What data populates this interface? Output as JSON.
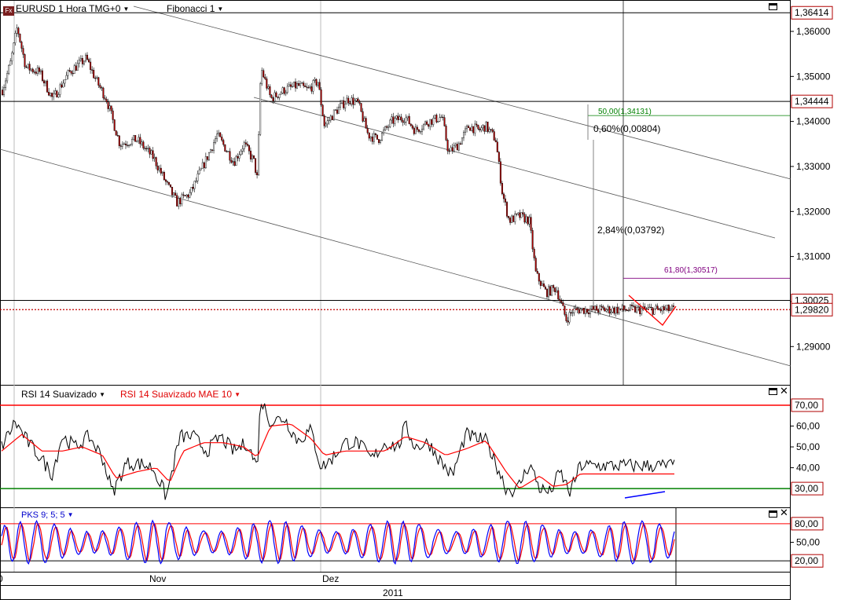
{
  "header": {
    "symbol_icon": "fx-icon",
    "symbol_label": "EURUSD 1 Hora TMG+0",
    "study_label": "Fibonacci 1"
  },
  "rsi_panel": {
    "title": "RSI 14 Suavizado",
    "ma_title": "RSI 14 Suavizado MAE 10"
  },
  "pks_panel": {
    "title": "PKS 9; 5; 5"
  },
  "x_axis": {
    "labels": [
      "Nov",
      "Dez"
    ],
    "year": "2011",
    "edge_label": "0"
  },
  "colors": {
    "price_up": "#000000",
    "price_down": "#b00000",
    "rsi_line": "#000000",
    "rsi_ma": "#ff0000",
    "pks_fast": "#0000ff",
    "pks_slow": "#ff0000",
    "upper_band": "#ff0000",
    "lower_band": "#008000",
    "fib_50": "#008000",
    "fib_618": "#800080",
    "axis_box_border": "#b00000"
  },
  "chart_data": [
    {
      "type": "candlestick",
      "title": "EURUSD 1 Hora TMG+0",
      "ylim": [
        1.2815,
        1.3668
      ],
      "yticks": [
        "1,36000",
        "1,35000",
        "1,34000",
        "1,33000",
        "1,32000",
        "1,31000",
        "1,30000",
        "1,29000"
      ],
      "tick_values": [
        1.36,
        1.35,
        1.34,
        1.33,
        1.32,
        1.31,
        1.3,
        1.29
      ],
      "value_boxes": [
        {
          "label": "1,36414",
          "value": 1.36414
        },
        {
          "label": "1,34444",
          "value": 1.34444
        },
        {
          "label": "1,30025",
          "value": 1.30025
        },
        {
          "label": "1,29820",
          "value": 1.2982
        }
      ],
      "horizontal_lines": [
        1.36414,
        1.34444,
        1.30025
      ],
      "current_price": 1.2982,
      "annotations": [
        {
          "text": "50,00(1,34131)",
          "value": 1.34131,
          "color": "#008000"
        },
        {
          "text": "0,60%(0,00804)"
        },
        {
          "text": "2,84%(0,03792)"
        },
        {
          "text": "61,80(1,30517)",
          "value": 1.30517,
          "color": "#800080"
        }
      ],
      "series": [
        {
          "name": "EURUSD",
          "path": [
            [
              0,
              1.347
            ],
            [
              0.012,
              1.353
            ],
            [
              0.022,
              1.361
            ],
            [
              0.035,
              1.352
            ],
            [
              0.055,
              1.351
            ],
            [
              0.075,
              1.345
            ],
            [
              0.1,
              1.351
            ],
            [
              0.125,
              1.354
            ],
            [
              0.14,
              1.349
            ],
            [
              0.155,
              1.345
            ],
            [
              0.175,
              1.335
            ],
            [
              0.2,
              1.336
            ],
            [
              0.225,
              1.332
            ],
            [
              0.245,
              1.326
            ],
            [
              0.26,
              1.322
            ],
            [
              0.28,
              1.324
            ],
            [
              0.305,
              1.332
            ],
            [
              0.32,
              1.337
            ],
            [
              0.345,
              1.331
            ],
            [
              0.36,
              1.335
            ],
            [
              0.375,
              1.331
            ],
            [
              0.38,
              1.327
            ],
            [
              0.385,
              1.352
            ],
            [
              0.4,
              1.345
            ],
            [
              0.42,
              1.347
            ],
            [
              0.44,
              1.348
            ],
            [
              0.455,
              1.347
            ],
            [
              0.47,
              1.349
            ],
            [
              0.48,
              1.339
            ],
            [
              0.495,
              1.342
            ],
            [
              0.515,
              1.345
            ],
            [
              0.53,
              1.344
            ],
            [
              0.545,
              1.337
            ],
            [
              0.56,
              1.336
            ],
            [
              0.58,
              1.34
            ],
            [
              0.6,
              1.341
            ],
            [
              0.615,
              1.338
            ],
            [
              0.635,
              1.34
            ],
            [
              0.655,
              1.341
            ],
            [
              0.665,
              1.333
            ],
            [
              0.68,
              1.335
            ],
            [
              0.695,
              1.339
            ],
            [
              0.71,
              1.338
            ],
            [
              0.72,
              1.339
            ],
            [
              0.735,
              1.336
            ],
            [
              0.745,
              1.324
            ],
            [
              0.755,
              1.318
            ],
            [
              0.77,
              1.319
            ],
            [
              0.785,
              1.318
            ],
            [
              0.795,
              1.306
            ],
            [
              0.81,
              1.302
            ],
            [
              0.825,
              1.303
            ],
            [
              0.84,
              1.296
            ],
            [
              0.85,
              1.298
            ],
            [
              0.86,
              1.2982
            ]
          ]
        }
      ]
    },
    {
      "type": "line",
      "title": "RSI 14 Suavizado",
      "ylim": [
        21,
        73
      ],
      "yticks": [
        "60,00",
        "50,00",
        "40,00"
      ],
      "tick_values": [
        60,
        50,
        40
      ],
      "bands": [
        {
          "label": "70,00",
          "value": 70,
          "color": "#ff0000"
        },
        {
          "label": "30,00",
          "value": 30,
          "color": "#008000"
        }
      ],
      "series": [
        {
          "name": "RSI 14 Suavizado",
          "path": [
            [
              0,
              50
            ],
            [
              0.02,
              62
            ],
            [
              0.04,
              52
            ],
            [
              0.06,
              44
            ],
            [
              0.075,
              37
            ],
            [
              0.09,
              55
            ],
            [
              0.11,
              50
            ],
            [
              0.13,
              55
            ],
            [
              0.15,
              45
            ],
            [
              0.165,
              28
            ],
            [
              0.185,
              42
            ],
            [
              0.205,
              42
            ],
            [
              0.225,
              40
            ],
            [
              0.245,
              26
            ],
            [
              0.265,
              55
            ],
            [
              0.285,
              55
            ],
            [
              0.305,
              48
            ],
            [
              0.325,
              55
            ],
            [
              0.345,
              48
            ],
            [
              0.365,
              52
            ],
            [
              0.38,
              40
            ],
            [
              0.385,
              73
            ],
            [
              0.4,
              62
            ],
            [
              0.42,
              64
            ],
            [
              0.44,
              53
            ],
            [
              0.46,
              58
            ],
            [
              0.475,
              40
            ],
            [
              0.49,
              44
            ],
            [
              0.51,
              52
            ],
            [
              0.53,
              52
            ],
            [
              0.55,
              44
            ],
            [
              0.57,
              52
            ],
            [
              0.59,
              50
            ],
            [
              0.6,
              60
            ],
            [
              0.615,
              50
            ],
            [
              0.635,
              52
            ],
            [
              0.655,
              42
            ],
            [
              0.67,
              36
            ],
            [
              0.69,
              56
            ],
            [
              0.705,
              54
            ],
            [
              0.72,
              53
            ],
            [
              0.735,
              42
            ],
            [
              0.75,
              30
            ],
            [
              0.765,
              29
            ],
            [
              0.785,
              42
            ],
            [
              0.8,
              30
            ],
            [
              0.815,
              28
            ],
            [
              0.83,
              38
            ],
            [
              0.845,
              28
            ],
            [
              0.86,
              41
            ]
          ]
        },
        {
          "name": "RSI 14 Suavizado MAE 10",
          "path": [
            [
              0,
              48
            ],
            [
              0.03,
              56
            ],
            [
              0.06,
              48
            ],
            [
              0.09,
              48
            ],
            [
              0.12,
              50
            ],
            [
              0.15,
              46
            ],
            [
              0.17,
              35
            ],
            [
              0.2,
              38
            ],
            [
              0.23,
              40
            ],
            [
              0.25,
              33
            ],
            [
              0.27,
              48
            ],
            [
              0.3,
              52
            ],
            [
              0.33,
              52
            ],
            [
              0.36,
              50
            ],
            [
              0.38,
              45
            ],
            [
              0.4,
              60
            ],
            [
              0.43,
              61
            ],
            [
              0.46,
              54
            ],
            [
              0.48,
              46
            ],
            [
              0.51,
              48
            ],
            [
              0.54,
              48
            ],
            [
              0.57,
              48
            ],
            [
              0.6,
              55
            ],
            [
              0.63,
              52
            ],
            [
              0.66,
              46
            ],
            [
              0.69,
              49
            ],
            [
              0.72,
              53
            ],
            [
              0.75,
              38
            ],
            [
              0.77,
              30
            ],
            [
              0.8,
              36
            ],
            [
              0.82,
              31
            ],
            [
              0.84,
              32
            ],
            [
              0.86,
              37
            ]
          ]
        }
      ]
    },
    {
      "type": "line",
      "title": "PKS 9; 5; 5",
      "ylim": [
        5,
        95
      ],
      "yticks": [
        "50,00"
      ],
      "tick_values": [
        50
      ],
      "bands": [
        {
          "label": "80,00",
          "value": 80,
          "color": "#ff0000"
        },
        {
          "label": "20,00",
          "value": 20,
          "color": "#000000"
        }
      ],
      "series": [
        {
          "name": "PKS fast",
          "cycles": 40,
          "min": 15,
          "max": 85
        },
        {
          "name": "PKS slow",
          "cycles": 40,
          "min": 20,
          "max": 80
        }
      ]
    }
  ]
}
